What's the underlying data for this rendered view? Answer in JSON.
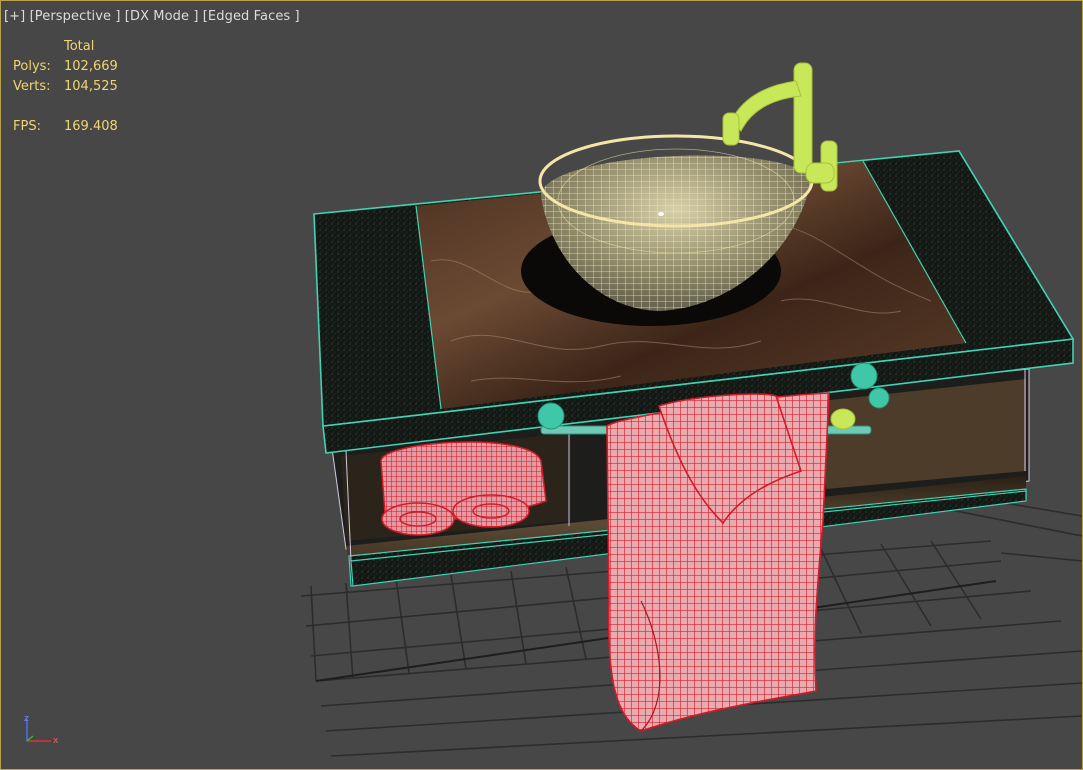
{
  "viewport": {
    "labels": {
      "plus": "[+]",
      "view": "[Perspective ]",
      "mode": "[DX Mode ]",
      "shading": "[Edged Faces ]"
    },
    "stats": {
      "header": "Total",
      "polys_label": "Polys:",
      "polys_value": "102,669",
      "verts_label": "Verts:",
      "verts_value": "104,525",
      "fps_label": "FPS:",
      "fps_value": "169.408"
    },
    "axis": {
      "x": "x",
      "z": "z"
    }
  },
  "colors": {
    "background": "#474747",
    "grid": "#2b2b2b",
    "stats_text": "#f0d66e",
    "wire_cabinet": "#3fd4b4",
    "wire_towel": "#e03040",
    "wire_basin": "#f5e6a8",
    "faucet": "#c8e85a",
    "hardware": "#3fc8a8"
  }
}
